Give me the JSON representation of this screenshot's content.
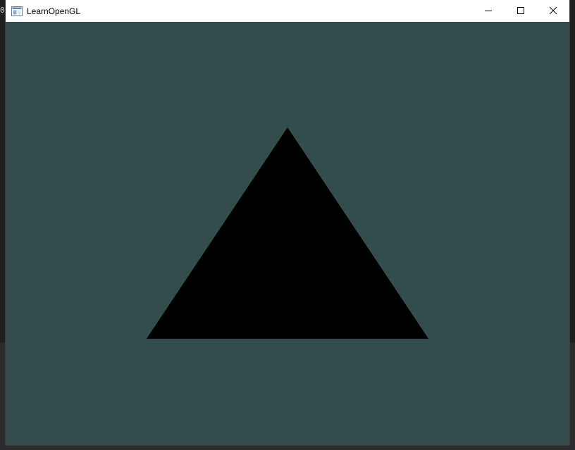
{
  "window": {
    "title": "LearnOpenGL",
    "icon": "app-window-icon",
    "controls": {
      "minimize_icon": "minimize-icon",
      "maximize_icon": "maximize-icon",
      "close_icon": "close-icon"
    }
  },
  "scene": {
    "clear_color": "#334c4c",
    "triangle_color": "#000000",
    "shape": "triangle"
  },
  "colors": {
    "titlebar": "#ffffff",
    "title_text": "#000000",
    "desktop": "#1e1e1e"
  }
}
